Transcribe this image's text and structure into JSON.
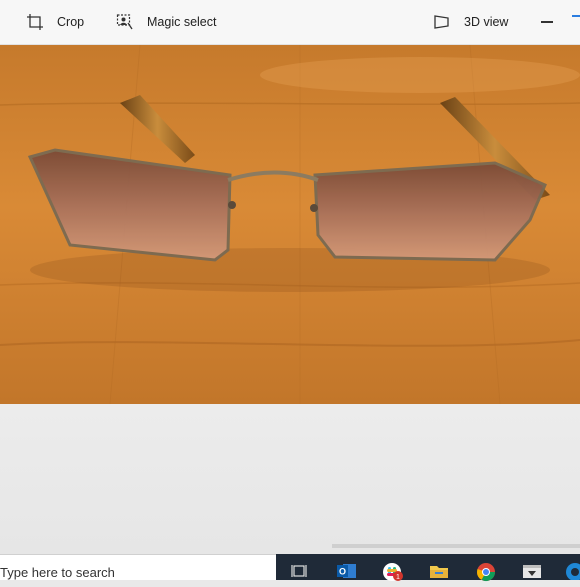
{
  "toolbar": {
    "crop_label": "Crop",
    "magic_select_label": "Magic select",
    "view3d_label": "3D view",
    "crop_icon": "crop-icon",
    "magic_select_icon": "magic-select-icon",
    "view3d_icon": "3d-view-icon",
    "minimize_icon": "minimize-icon"
  },
  "canvas": {
    "image_subject": "sunglasses-on-wooden-floor"
  },
  "taskbar": {
    "search_placeholder": "Type here to search",
    "pinned_icons": [
      "task-view-icon",
      "outlook-icon",
      "slack-icon",
      "file-explorer-icon",
      "chrome-icon",
      "store-icon",
      "edge-icon"
    ],
    "slack_badge": "1"
  },
  "colors": {
    "toolbar_bg": "#f7f7f7",
    "taskbar_bg": "#1f2a38",
    "accent": "#2b7de0"
  }
}
